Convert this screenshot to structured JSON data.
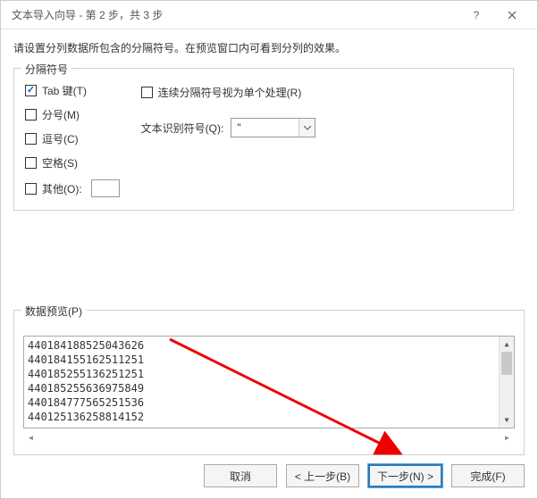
{
  "titlebar": {
    "title": "文本导入向导 - 第 2 步，共 3 步"
  },
  "instruction": "请设置分列数据所包含的分隔符号。在预览窗口内可看到分列的效果。",
  "delimGroup": {
    "title": "分隔符号",
    "tab": "Tab 键(T)",
    "semicolon": "分号(M)",
    "comma": "逗号(C)",
    "space": "空格(S)",
    "other": "其他(O):",
    "otherValue": "",
    "consecutive": "连续分隔符号视为单个处理(R)",
    "qualifierLabel": "文本识别符号(Q):",
    "qualifierValue": "\""
  },
  "previewGroup": {
    "title": "数据预览(P)",
    "lines": [
      "440184188525043626",
      "440184155162511251",
      "440185255136251251",
      "440185255636975849",
      "440184777565251536",
      "440125136258814152"
    ]
  },
  "footer": {
    "cancel": "取消",
    "back": "< 上一步(B)",
    "next": "下一步(N) >",
    "finish": "完成(F)"
  }
}
